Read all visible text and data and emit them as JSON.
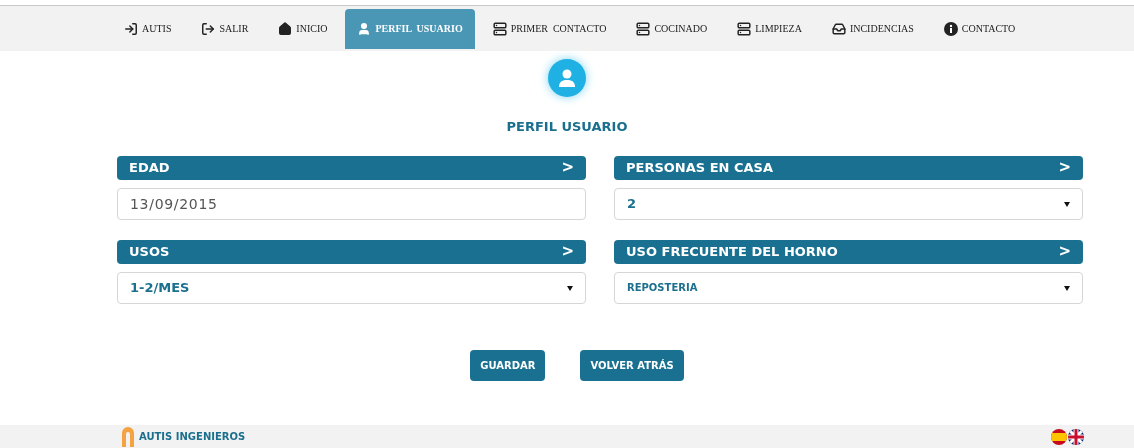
{
  "nav": [
    {
      "label": "AUTIS",
      "selected": false
    },
    {
      "label": "SALIR",
      "selected": false
    },
    {
      "label": "INICIO",
      "selected": false
    },
    {
      "label": "PERFIL  USUARIO",
      "selected": true
    },
    {
      "label": "PRIMER  CONTACTO",
      "selected": false
    },
    {
      "label": "COCINADO",
      "selected": false
    },
    {
      "label": "LIMPIEZA",
      "selected": false
    },
    {
      "label": "INCIDENCIAS",
      "selected": false
    },
    {
      "label": "CONTACTO",
      "selected": false
    }
  ],
  "page_title": "PERFIL USUARIO",
  "fields": [
    {
      "label": "EDAD",
      "arrow": ">",
      "kind": "input",
      "value": "13/09/2015"
    },
    {
      "label": "PERSONAS EN CASA",
      "arrow": ">",
      "kind": "select",
      "value": "2"
    },
    {
      "label": "USOS",
      "arrow": ">",
      "kind": "select",
      "value": "1-2/MES"
    },
    {
      "label": "USO FRECUENTE DEL HORNO",
      "arrow": ">",
      "kind": "select",
      "value": "REPOSTERIA"
    }
  ],
  "buttons": [
    "GUARDAR",
    "VOLVER ATRÁS"
  ],
  "footer": {
    "brand": "AUTIS INGENIEROS"
  }
}
